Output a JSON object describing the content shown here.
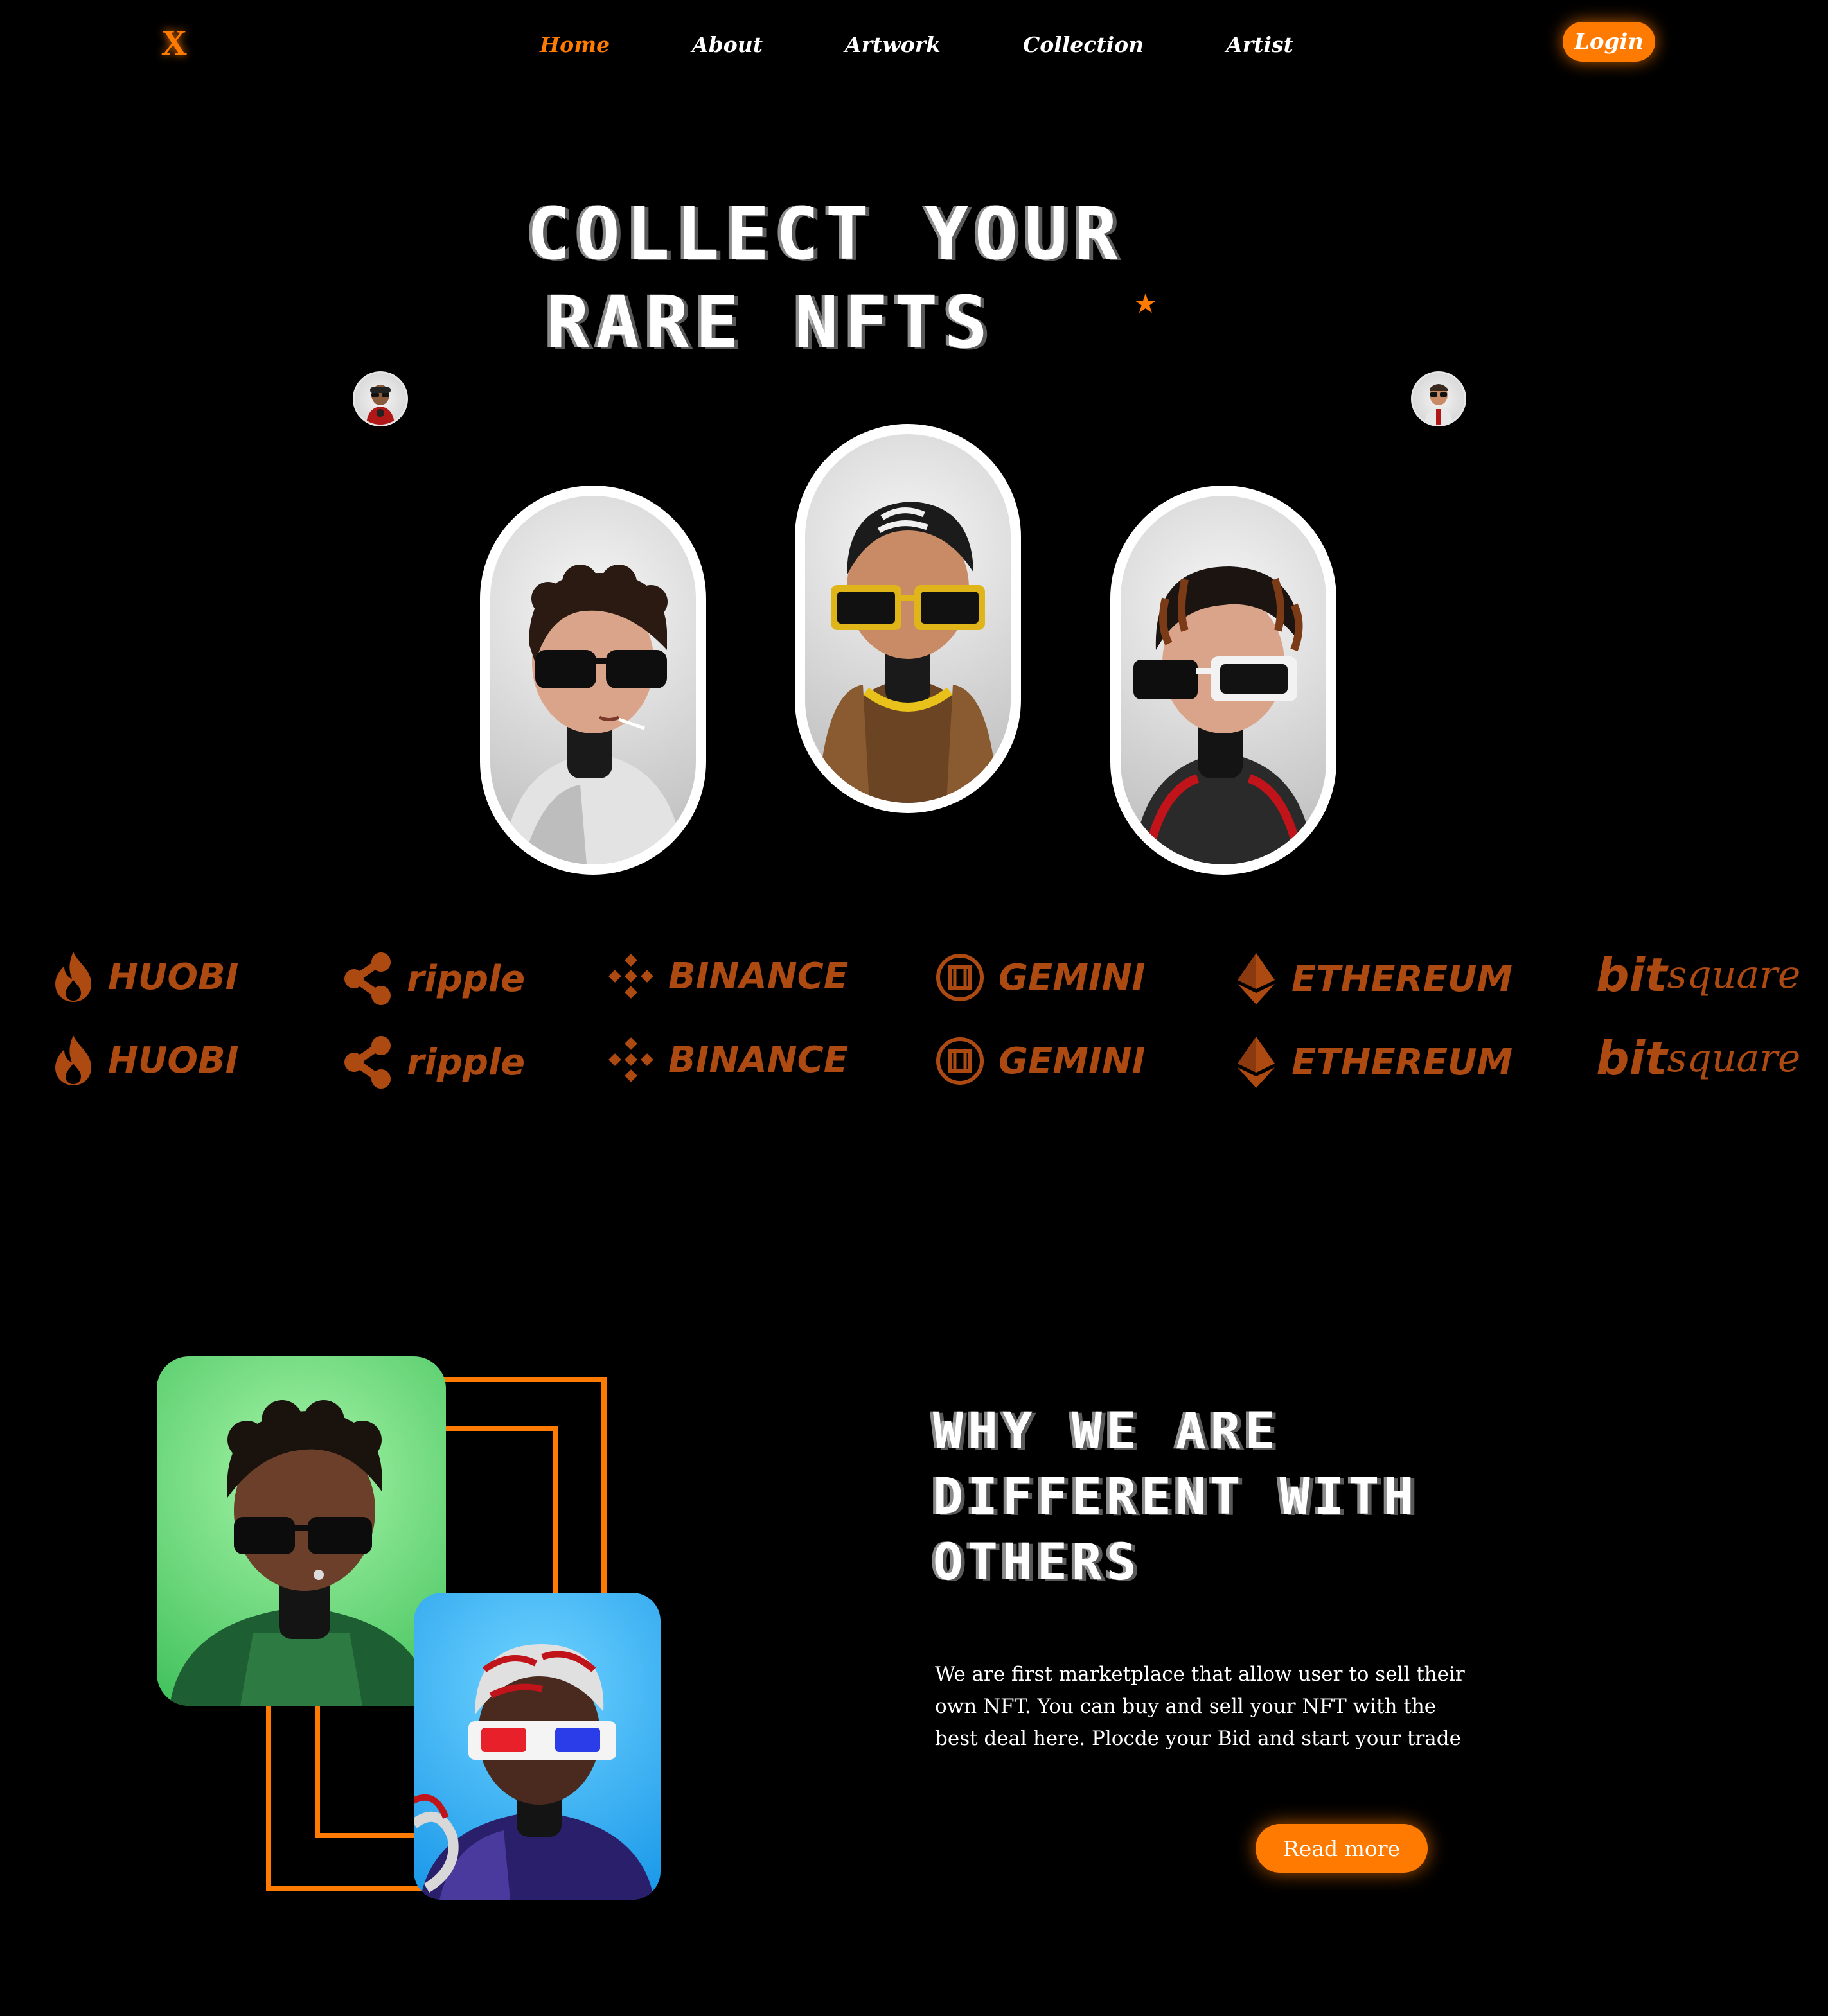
{
  "brand": {
    "logo_letter": "X",
    "accent_color": "#ff7a00"
  },
  "nav": {
    "items": [
      {
        "label": "Home",
        "active": true
      },
      {
        "label": "About",
        "active": false
      },
      {
        "label": "Artwork",
        "active": false
      },
      {
        "label": "Collection",
        "active": false
      },
      {
        "label": "Artist",
        "active": false
      }
    ],
    "login_label": "Login"
  },
  "hero": {
    "title_line1": "Collect your",
    "title_line2": "rare NFTs",
    "star_glyph": "★"
  },
  "partners": {
    "rows": 2,
    "logos": [
      {
        "name": "HUOBI",
        "icon": "flame-icon"
      },
      {
        "name": "ripple",
        "icon": "ripple-icon"
      },
      {
        "name": "BINANCE",
        "icon": "binance-icon"
      },
      {
        "name": "GEMINI",
        "icon": "gemini-icon"
      },
      {
        "name": "ETHEREUM",
        "icon": "ethereum-icon"
      },
      {
        "name_a": "bit",
        "name_b": "square",
        "icon": "none"
      }
    ],
    "color": "#ad4a12"
  },
  "feature": {
    "title_line1": "Why we are",
    "title_line2": "different with",
    "title_line3": "others",
    "description": "We are first marketplace that allow user to sell their own NFT. You can buy and sell your NFT with the best deal here. Plocde your Bid and start your trade",
    "read_more_label": "Read more"
  }
}
